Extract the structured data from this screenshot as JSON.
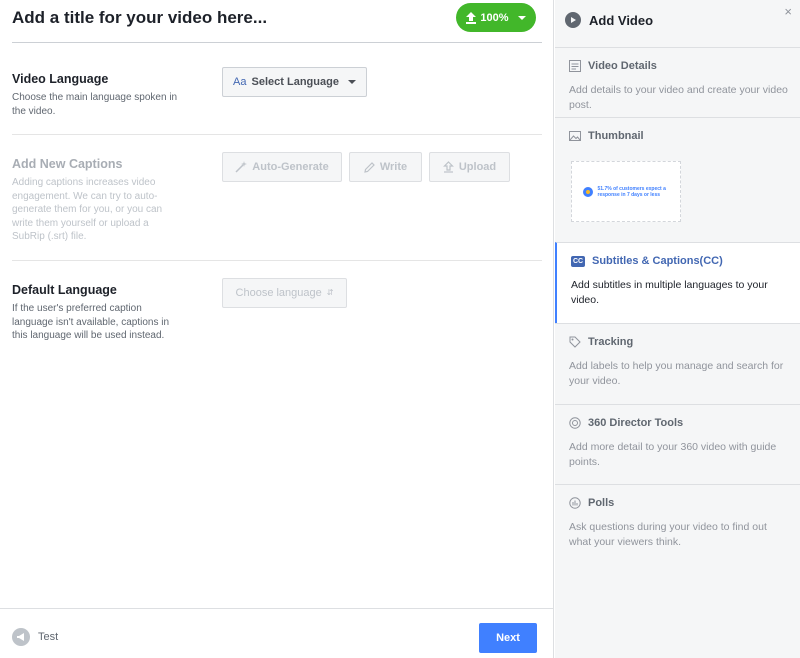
{
  "header": {
    "title_placeholder": "Add a title for your video here...",
    "progress_label": "100%",
    "progress_color": "#42b72a"
  },
  "sections": {
    "video_language": {
      "title": "Video Language",
      "description": "Choose the main language spoken in the video.",
      "button_prefix": "Aa",
      "button_label": "Select Language"
    },
    "captions": {
      "title": "Add New Captions",
      "description": "Adding captions increases video engagement. We can try to auto-generate them for you, or you can write them yourself or upload a SubRip (.srt) file.",
      "auto_label": "Auto-Generate",
      "write_label": "Write",
      "upload_label": "Upload"
    },
    "default_language": {
      "title": "Default Language",
      "description": "If the user's preferred caption language isn't available, captions in this language will be used instead.",
      "select_label": "Choose language"
    }
  },
  "footer": {
    "test_label": "Test",
    "next_label": "Next",
    "next_color": "#4080ff"
  },
  "sidebar": {
    "title": "Add Video",
    "close_glyph": "×",
    "items": [
      {
        "label": "Video Details",
        "description": "Add details to your video and create your video post.",
        "icon": "document-icon"
      },
      {
        "label": "Thumbnail",
        "description": "",
        "icon": "image-icon",
        "thumb_text": "51.7% of customers expect a response in 7 days or less"
      },
      {
        "label": "Subtitles & Captions(CC)",
        "description": "Add subtitles in multiple languages to your video.",
        "icon": "cc-icon",
        "badge": "CC",
        "active": true
      },
      {
        "label": "Tracking",
        "description": "Add labels to help you manage and search for your video.",
        "icon": "tag-icon"
      },
      {
        "label": "360 Director Tools",
        "description": "Add more detail to your 360 video with guide points.",
        "icon": "target-icon"
      },
      {
        "label": "Polls",
        "description": "Ask questions during your video to find out what your viewers think.",
        "icon": "poll-icon"
      }
    ],
    "accent_color": "#4080ff"
  }
}
